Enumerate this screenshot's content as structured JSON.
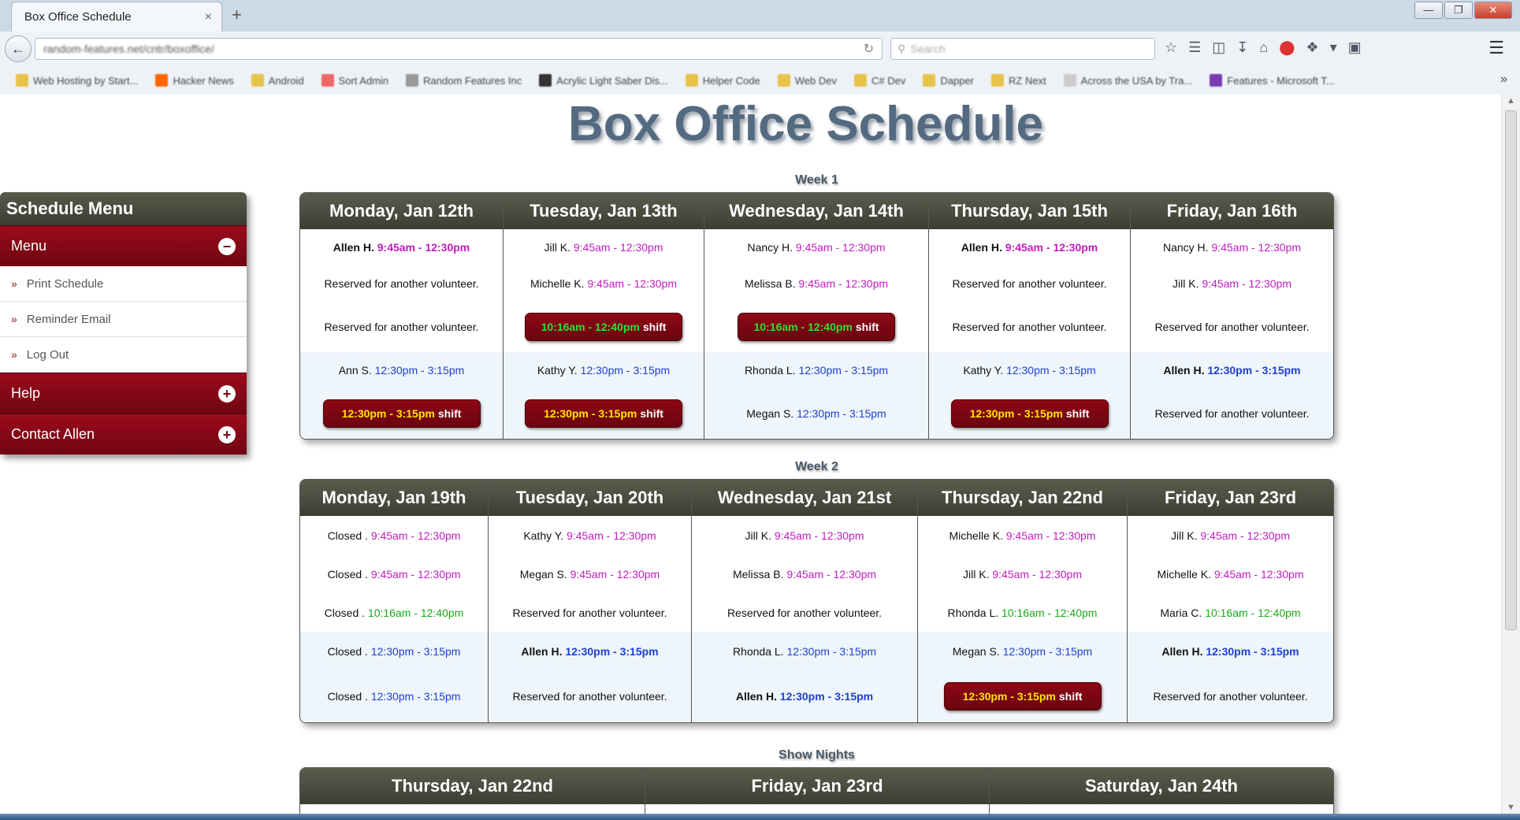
{
  "browser": {
    "tab_title": "Box Office Schedule",
    "tab_close": "×",
    "new_tab": "+",
    "url": "random-features.net/cntr/boxoffice/",
    "search_placeholder": "Search",
    "bookmarks": [
      "Web Hosting by Start...",
      "Hacker News",
      "Android",
      "Sort Admin",
      "Random Features Inc",
      "Acrylic Light Saber Dis...",
      "Helper Code",
      "Web Dev",
      "C# Dev",
      "Dapper",
      "RZ Next",
      "Across the USA by Tra...",
      "Features - Microsoft T..."
    ],
    "win_min": "—",
    "win_max": "❐",
    "win_close": "✕"
  },
  "page": {
    "title": "Box Office Schedule"
  },
  "menu": {
    "heading": "Schedule Menu",
    "sections": [
      {
        "label": "Menu",
        "toggle": "−",
        "items": [
          "Print Schedule",
          "Reminder Email",
          "Log Out"
        ]
      },
      {
        "label": "Help",
        "toggle": "+"
      },
      {
        "label": "Contact Allen",
        "toggle": "+"
      }
    ]
  },
  "shift_suffix": "shift",
  "week1": {
    "label": "Week 1",
    "days": [
      {
        "name": "Monday, Jan 12th",
        "slots": [
          {
            "who": "Allen H.",
            "time": "9:45am - 12:30pm",
            "kind": "am",
            "bold": true
          },
          {
            "reserved": "Reserved for another volunteer."
          },
          {
            "reserved": "Reserved for another volunteer."
          },
          {
            "who": "Ann S.",
            "time": "12:30pm - 3:15pm",
            "kind": "pm"
          },
          {
            "button": "12:30pm - 3:15pm",
            "kind": "pm"
          }
        ]
      },
      {
        "name": "Tuesday, Jan 13th",
        "slots": [
          {
            "who": "Jill K.",
            "time": "9:45am - 12:30pm",
            "kind": "am"
          },
          {
            "who": "Michelle K.",
            "time": "9:45am - 12:30pm",
            "kind": "am"
          },
          {
            "button": "10:16am - 12:40pm",
            "kind": "mid"
          },
          {
            "who": "Kathy Y.",
            "time": "12:30pm - 3:15pm",
            "kind": "pm"
          },
          {
            "button": "12:30pm - 3:15pm",
            "kind": "pm"
          }
        ]
      },
      {
        "name": "Wednesday, Jan 14th",
        "slots": [
          {
            "who": "Nancy H.",
            "time": "9:45am - 12:30pm",
            "kind": "am"
          },
          {
            "who": "Melissa B.",
            "time": "9:45am - 12:30pm",
            "kind": "am"
          },
          {
            "button": "10:16am - 12:40pm",
            "kind": "mid"
          },
          {
            "who": "Rhonda L.",
            "time": "12:30pm - 3:15pm",
            "kind": "pm"
          },
          {
            "who": "Megan S.",
            "time": "12:30pm - 3:15pm",
            "kind": "pm"
          }
        ]
      },
      {
        "name": "Thursday, Jan 15th",
        "slots": [
          {
            "who": "Allen H.",
            "time": "9:45am - 12:30pm",
            "kind": "am",
            "bold": true
          },
          {
            "reserved": "Reserved for another volunteer."
          },
          {
            "reserved": "Reserved for another volunteer."
          },
          {
            "who": "Kathy Y.",
            "time": "12:30pm - 3:15pm",
            "kind": "pm"
          },
          {
            "button": "12:30pm - 3:15pm",
            "kind": "pm"
          }
        ]
      },
      {
        "name": "Friday, Jan 16th",
        "slots": [
          {
            "who": "Nancy H.",
            "time": "9:45am - 12:30pm",
            "kind": "am"
          },
          {
            "who": "Jill K.",
            "time": "9:45am - 12:30pm",
            "kind": "am"
          },
          {
            "reserved": "Reserved for another volunteer."
          },
          {
            "who": "Allen H.",
            "time": "12:30pm - 3:15pm",
            "kind": "pm",
            "bold": true
          },
          {
            "reserved": "Reserved for another volunteer."
          }
        ]
      }
    ]
  },
  "week2": {
    "label": "Week 2",
    "days": [
      {
        "name": "Monday, Jan 19th",
        "slots": [
          {
            "who": "Closed .",
            "time": "9:45am - 12:30pm",
            "kind": "am"
          },
          {
            "who": "Closed .",
            "time": "9:45am - 12:30pm",
            "kind": "am"
          },
          {
            "who": "Closed .",
            "time": "10:16am - 12:40pm",
            "kind": "mid"
          },
          {
            "who": "Closed .",
            "time": "12:30pm - 3:15pm",
            "kind": "pm"
          },
          {
            "who": "Closed .",
            "time": "12:30pm - 3:15pm",
            "kind": "pm"
          }
        ]
      },
      {
        "name": "Tuesday, Jan 20th",
        "slots": [
          {
            "who": "Kathy Y.",
            "time": "9:45am - 12:30pm",
            "kind": "am"
          },
          {
            "who": "Megan S.",
            "time": "9:45am - 12:30pm",
            "kind": "am"
          },
          {
            "reserved": "Reserved for another volunteer."
          },
          {
            "who": "Allen H.",
            "time": "12:30pm - 3:15pm",
            "kind": "pm",
            "bold": true
          },
          {
            "reserved": "Reserved for another volunteer."
          }
        ]
      },
      {
        "name": "Wednesday, Jan 21st",
        "slots": [
          {
            "who": "Jill K.",
            "time": "9:45am - 12:30pm",
            "kind": "am"
          },
          {
            "who": "Melissa B.",
            "time": "9:45am - 12:30pm",
            "kind": "am"
          },
          {
            "reserved": "Reserved for another volunteer."
          },
          {
            "who": "Rhonda L.",
            "time": "12:30pm - 3:15pm",
            "kind": "pm"
          },
          {
            "who": "Allen H.",
            "time": "12:30pm - 3:15pm",
            "kind": "pm",
            "bold": true
          }
        ]
      },
      {
        "name": "Thursday, Jan 22nd",
        "slots": [
          {
            "who": "Michelle K.",
            "time": "9:45am - 12:30pm",
            "kind": "am"
          },
          {
            "who": "Jill K.",
            "time": "9:45am - 12:30pm",
            "kind": "am"
          },
          {
            "who": "Rhonda L.",
            "time": "10:16am - 12:40pm",
            "kind": "mid"
          },
          {
            "who": "Megan S.",
            "time": "12:30pm - 3:15pm",
            "kind": "pm"
          },
          {
            "button": "12:30pm - 3:15pm",
            "kind": "pm"
          }
        ]
      },
      {
        "name": "Friday, Jan 23rd",
        "slots": [
          {
            "who": "Jill K.",
            "time": "9:45am - 12:30pm",
            "kind": "am"
          },
          {
            "who": "Michelle K.",
            "time": "9:45am - 12:30pm",
            "kind": "am"
          },
          {
            "who": "Maria C.",
            "time": "10:16am - 12:40pm",
            "kind": "mid"
          },
          {
            "who": "Allen H.",
            "time": "12:30pm - 3:15pm",
            "kind": "pm",
            "bold": true
          },
          {
            "reserved": "Reserved for another volunteer."
          }
        ]
      }
    ]
  },
  "shows": {
    "label": "Show Nights",
    "days": [
      {
        "name": "Thursday, Jan 22nd"
      },
      {
        "name": "Friday, Jan 23rd"
      },
      {
        "name": "Saturday, Jan 24th"
      }
    ]
  }
}
